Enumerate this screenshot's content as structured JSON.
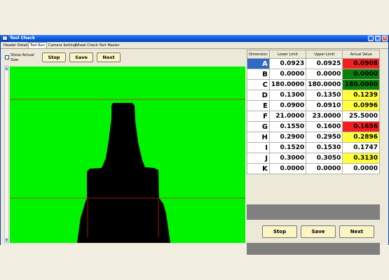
{
  "window": {
    "title": "Tool Check"
  },
  "tabs": [
    "Header Details",
    "Tool Run",
    "Camera Setting",
    "Wheel Check",
    "Part Master"
  ],
  "active_tab": "Tool Run",
  "left_panel": {
    "show_actual_size_label": "Show Actual Size",
    "show_actual_size_checked": false,
    "stop_label": "Stop",
    "save_label": "Save",
    "next_label": "Next"
  },
  "table": {
    "headers": [
      "Dimension",
      "Lower Limit",
      "Upper Limit",
      "Actual Value"
    ],
    "rows": [
      {
        "dim": "A",
        "lower": "0.0923",
        "upper": "0.0925",
        "actual": "0.0908",
        "status": "red"
      },
      {
        "dim": "B",
        "lower": "0.0000",
        "upper": "0.0000",
        "actual": "0.0000",
        "status": "green"
      },
      {
        "dim": "C",
        "lower": "180.0000",
        "upper": "180.0000",
        "actual": "180.0000",
        "status": "green"
      },
      {
        "dim": "D",
        "lower": "0.1300",
        "upper": "0.1350",
        "actual": "0.1239",
        "status": "yellow"
      },
      {
        "dim": "E",
        "lower": "0.0900",
        "upper": "0.0910",
        "actual": "0.0996",
        "status": "yellow"
      },
      {
        "dim": "F",
        "lower": "21.0000",
        "upper": "23.0000",
        "actual": "25.5000",
        "status": "none"
      },
      {
        "dim": "G",
        "lower": "0.1550",
        "upper": "0.1600",
        "actual": "0.1656",
        "status": "red"
      },
      {
        "dim": "H",
        "lower": "0.2900",
        "upper": "0.2950",
        "actual": "0.2896",
        "status": "yellow"
      },
      {
        "dim": "I",
        "lower": "0.1520",
        "upper": "0.1530",
        "actual": "0.1747",
        "status": "none"
      },
      {
        "dim": "J",
        "lower": "0.3000",
        "upper": "0.3050",
        "actual": "0.3130",
        "status": "yellow"
      },
      {
        "dim": "K",
        "lower": "0.0000",
        "upper": "0.0000",
        "actual": "0.0000",
        "status": "none"
      }
    ],
    "selected_row": "A"
  },
  "right_panel": {
    "stop_label": "Stop",
    "save_label": "Save",
    "next_label": "Next"
  },
  "colors": {
    "image_background": "#00f400",
    "tool_silhouette": "#000000",
    "guide_lines": "#cc2020"
  }
}
